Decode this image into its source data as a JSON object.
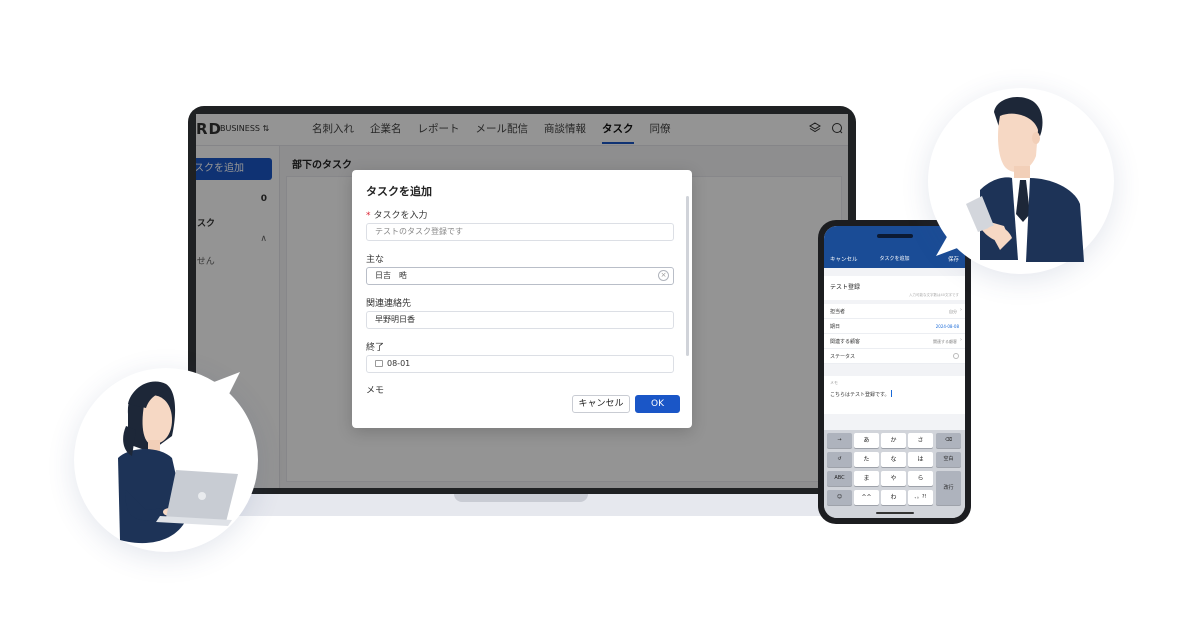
{
  "app": {
    "brand": "RD",
    "plan": "BUSINESS ⇅",
    "nav": [
      "名刺入れ",
      "企業名",
      "レポート",
      "メール配信",
      "商談情報",
      "タスク",
      "同僚"
    ],
    "nav_active_index": 5
  },
  "sidebar": {
    "add_task_button": "スクを追加",
    "count": "0",
    "section_label": "タスク",
    "empty_text": "ません"
  },
  "main": {
    "title": "部下のタスク"
  },
  "modal": {
    "title": "タスクを追加",
    "task_label": "タスクを入力",
    "task_placeholder": "テストのタスク登録です",
    "owner_label": "主な",
    "owner_value": "日吉　晧",
    "contact_label": "関連連絡先",
    "contact_value": "早野明日香",
    "end_label": "終了",
    "end_value": "08-01",
    "memo_label": "メモ",
    "cancel_button": "キャンセル",
    "ok_button": "OK"
  },
  "phone": {
    "header_left": "キャンセル",
    "header_title": "タスクを追加",
    "header_right": "保存",
    "task_title": "テスト登録",
    "hint": "入力可能な文字数は40文字です",
    "rows": [
      {
        "label": "担当者",
        "value": "自分"
      },
      {
        "label": "期日",
        "value": "2024-08-08"
      },
      {
        "label": "関連する顧客",
        "value": "関連する顧客"
      },
      {
        "label": "ステータス",
        "value": ""
      }
    ],
    "memo_label": "メモ",
    "memo_text": "こちらはテスト登録です。",
    "keyboard": [
      [
        "→",
        "あ",
        "か",
        "さ",
        "⌫"
      ],
      [
        "↺",
        "た",
        "な",
        "は",
        "空白"
      ],
      [
        "ABC",
        "ま",
        "や",
        "ら",
        "改行"
      ],
      [
        "☺",
        "^^",
        "わ",
        "、。?!",
        ""
      ]
    ]
  },
  "colors": {
    "accent": "#1a56c7",
    "phone_header": "#1a4c96",
    "navy_suit": "#1d3357",
    "date_blue": "#1a6ad8"
  }
}
